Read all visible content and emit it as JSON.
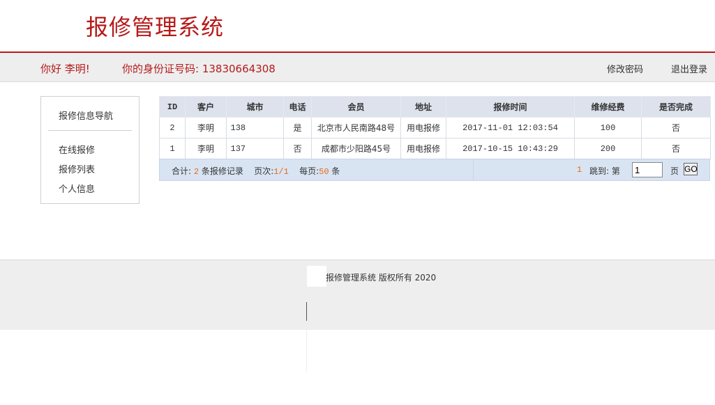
{
  "app": {
    "title": "报修管理系统"
  },
  "userbar": {
    "greeting": "你好 李明!",
    "idcard_label": "你的身份证号码:",
    "idcard_value": "13830664308",
    "change_password": "修改密码",
    "logout": "退出登录"
  },
  "sidebar": {
    "title": "报修信息导航",
    "items": [
      {
        "label": "在线报修"
      },
      {
        "label": "报修列表"
      },
      {
        "label": "个人信息"
      }
    ]
  },
  "table": {
    "headers": [
      "ID",
      "客户",
      "城市",
      "电话",
      "会员",
      "地址",
      "报修时间",
      "维修经费",
      "是否完成"
    ],
    "rows": [
      [
        "2",
        "李明",
        "138",
        "是",
        "北京市人民南路48号",
        "用电报修",
        "2017-11-01 12:03:54",
        "100",
        "否"
      ],
      [
        "1",
        "李明",
        "137",
        "否",
        "成都市少阳路45号",
        "用电报修",
        "2017-10-15 10:43:29",
        "200",
        "否"
      ]
    ]
  },
  "pager": {
    "total_label": "合计:",
    "total_value": "2",
    "total_unit": "条报修记录",
    "pages_label": "页次:",
    "pages_value": "1/1",
    "per_page_label": "每页:",
    "per_page_value": "50",
    "per_page_unit": "条",
    "current": "1",
    "jump_label": "跳到: 第",
    "jump_value": "1",
    "page_unit": "页",
    "go": "GO"
  },
  "footer": {
    "text": "报修管理系统 版权所有   2020"
  }
}
